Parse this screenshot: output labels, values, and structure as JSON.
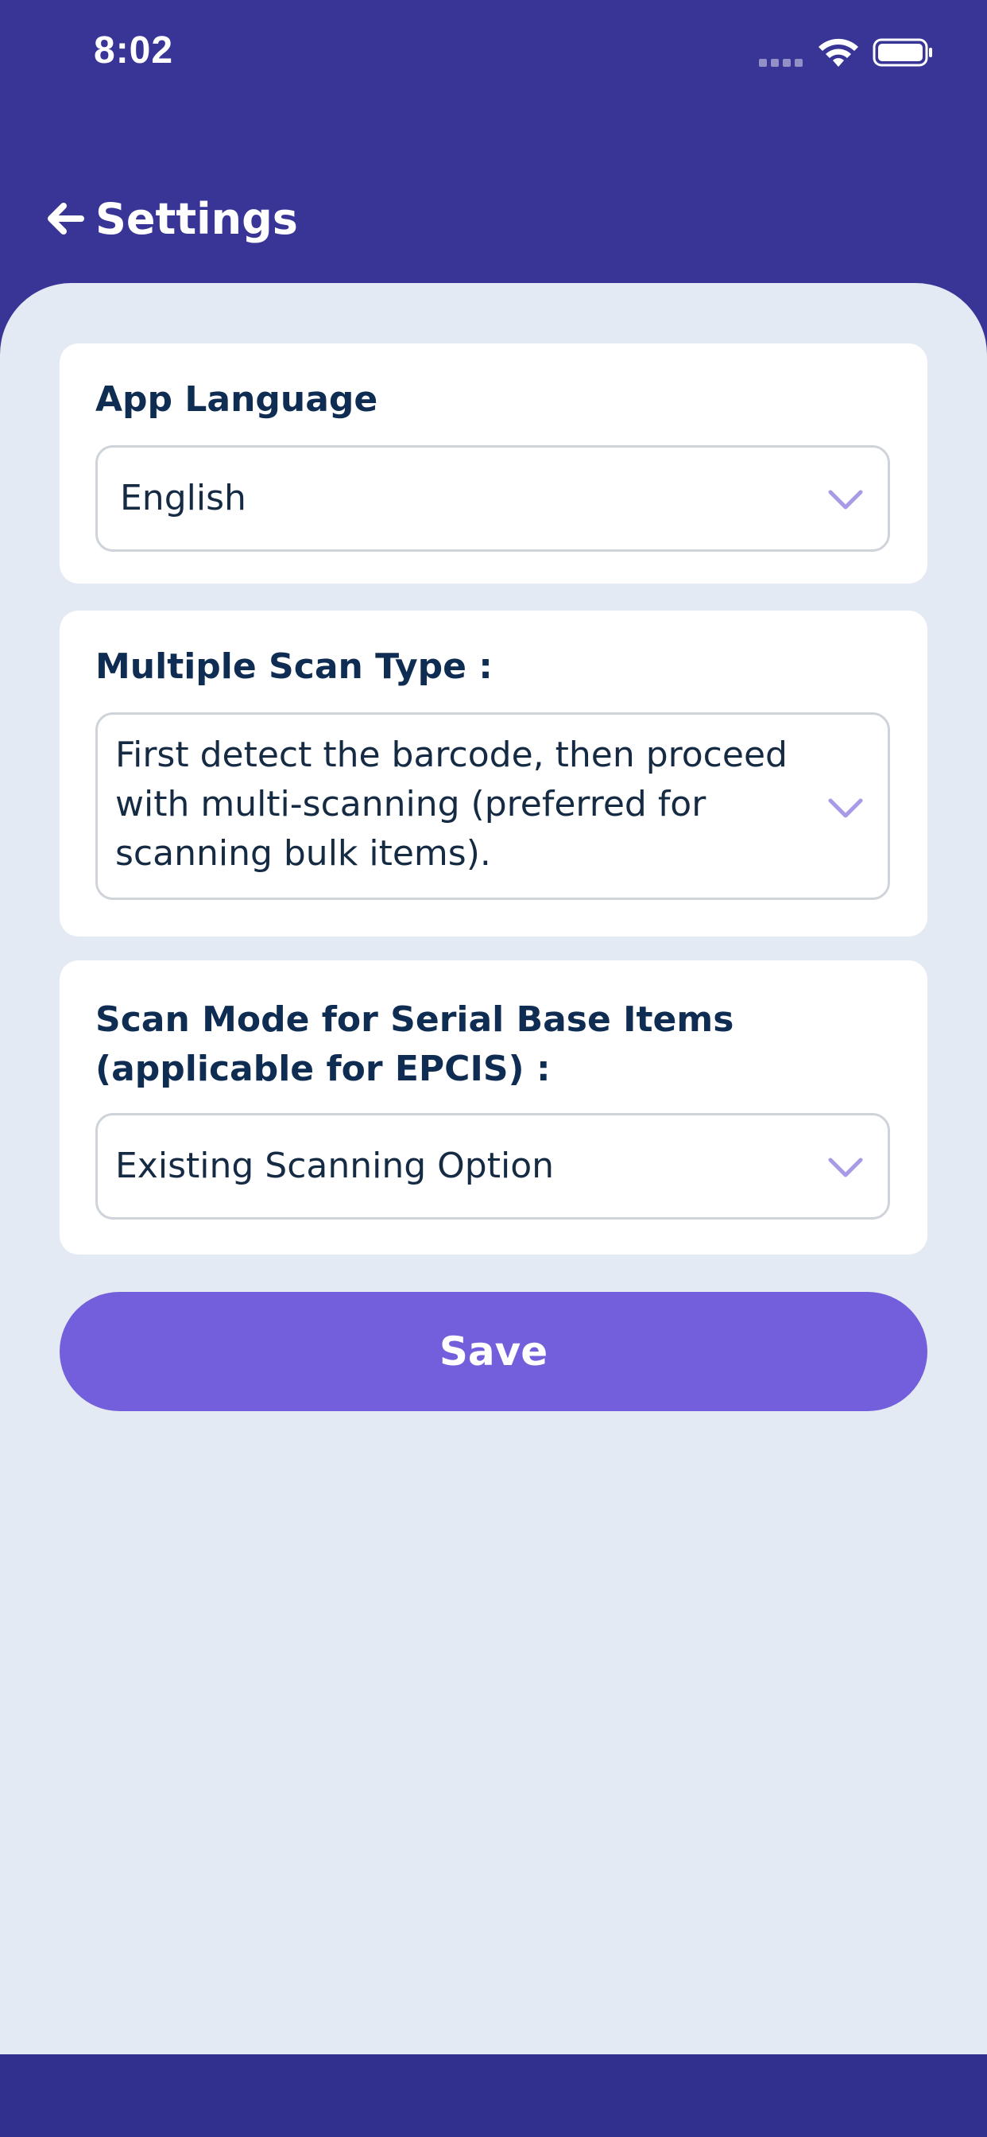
{
  "status_bar": {
    "time": "8:02"
  },
  "header": {
    "title": "Settings",
    "back_icon": "arrow-left-icon"
  },
  "settings": {
    "app_language": {
      "label": "App Language",
      "value": "English"
    },
    "multiple_scan_type": {
      "label": "Multiple Scan Type :",
      "value": "First detect the barcode, then proceed with multi-scanning (preferred for scanning bulk items)."
    },
    "scan_mode": {
      "label": "Scan Mode for Serial Base Items (applicable for EPCIS) :",
      "value": "Existing Scanning Option"
    }
  },
  "actions": {
    "save_label": "Save"
  },
  "colors": {
    "primary": "#393597",
    "background": "#e4eaf4",
    "button": "#735fdc",
    "label": "#0f2d52",
    "chevron": "#a89ae6"
  }
}
